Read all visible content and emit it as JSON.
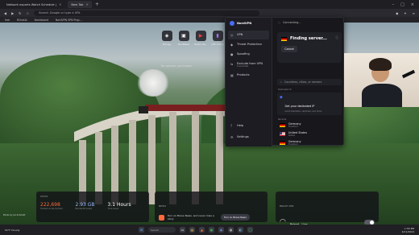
{
  "browser": {
    "tabs": [
      {
        "label": "Network exports Watch Schedule | "
      },
      {
        "label": "New Tab"
      }
    ],
    "new_tab_symbol": "+",
    "close_symbol": "×",
    "window_controls": [
      "–",
      "□",
      "×"
    ],
    "url_placeholder": "Search Google or type a URL",
    "bookmarks": [
      "Ikat",
      "RChatAI",
      "Dashboard",
      "NordVPN VPN Prop..."
    ]
  },
  "newtab": {
    "shortcuts": [
      {
        "label": "NYA.gg",
        "icon": "shield-icon"
      },
      {
        "label": "NordNews",
        "icon": "news-icon"
      },
      {
        "label": "Studio Ha...",
        "icon": "youtube-icon"
      },
      {
        "label": "UFC.com p",
        "icon": "twitch-icon"
      }
    ],
    "sponsored_text": "No sponsor. Just browse."
  },
  "vpn": {
    "brand": "NordVPN",
    "status": "Connecting...",
    "nav": [
      {
        "label": "VPN",
        "sub": ""
      },
      {
        "label": "Threat Protection",
        "sub": ""
      },
      {
        "label": "Spoofing",
        "sub": ""
      },
      {
        "label": "Exclude from VPN",
        "sub": "0 excluded"
      },
      {
        "label": "Products",
        "sub": ""
      }
    ],
    "nav_bottom": [
      "Help",
      "Settings"
    ],
    "finding": "Finding server...",
    "cancel": "Cancel",
    "search_placeholder": "Countries, cities, or servers",
    "dedicated_header": "Dedicated IP",
    "dedicated_title": "Get your dedicated IP",
    "dedicated_sub": "Avoid blacklists, captchas, and more",
    "recents_header": "Recents",
    "locations": [
      {
        "country": "Germany",
        "city": "Frankfurt",
        "flag": "germany"
      },
      {
        "country": "United States",
        "city": "Dallas",
        "flag": "usa"
      },
      {
        "country": "Germany",
        "city": "Frankfurt",
        "flag": "germany"
      }
    ]
  },
  "widgets": {
    "stats_header": "STATS",
    "stats": [
      {
        "value": "222,698",
        "caption": "Trackers & ads blocked"
      },
      {
        "value": "2.93 GB",
        "caption": "Bandwidth saved"
      },
      {
        "value": "3.1 Hours",
        "caption": "Time saved"
      }
    ],
    "news_header": "NEWS",
    "news_text": "Turn on Brave News, and never miss a story",
    "news_button": "Turn on Brave News",
    "bvpn_header": "BRAVE VPN",
    "bvpn_title": "Poland - Live",
    "bvpn_sub": "Disconnected"
  },
  "photo_credit": "Photo by Lili Schmidt",
  "taskbar": {
    "weather": "52°F Cloudy",
    "search_placeholder": "Search",
    "time": "1:55 PM",
    "date": "4/11/2024"
  },
  "colors": {
    "accent": "#4a6cf7",
    "brave_orange": "#ff6a3d"
  }
}
